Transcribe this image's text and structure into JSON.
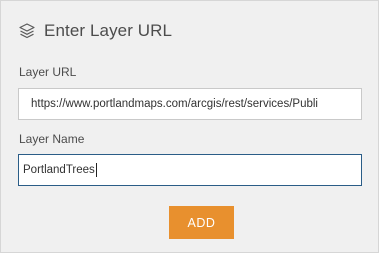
{
  "header": {
    "title": "Enter Layer URL",
    "icon": "layers-icon"
  },
  "form": {
    "url_label": "Layer URL",
    "url_value": "https://www.portlandmaps.com/arcgis/rest/services/Publi",
    "name_label": "Layer Name",
    "name_value": "PortlandTrees"
  },
  "actions": {
    "add_label": "ADD"
  },
  "colors": {
    "accent": "#e8902e",
    "panel_bg": "#f0f0f0",
    "focus_border": "#2a5d87"
  }
}
